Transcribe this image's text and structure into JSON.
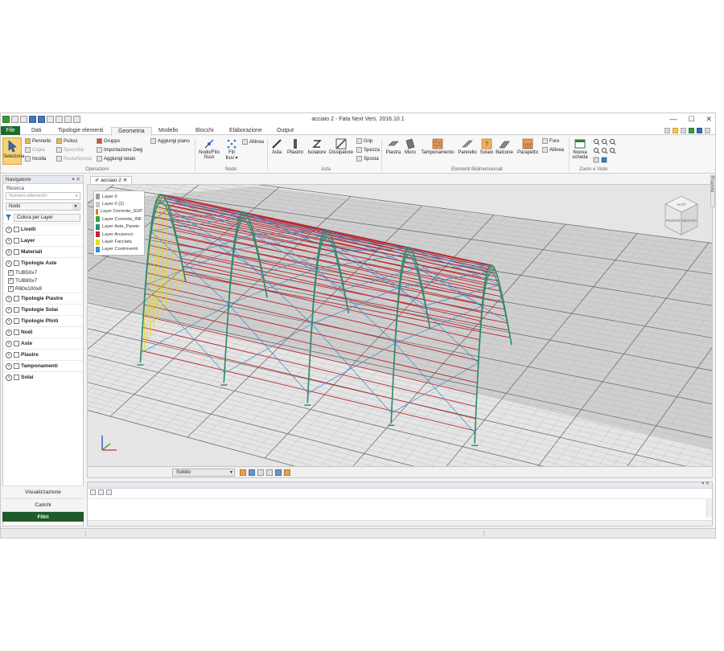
{
  "window": {
    "title": "acciaio 2 - Fata Next Vers. 2016.10.1",
    "controls": [
      "—",
      "☐",
      "✕"
    ]
  },
  "menu_tabs": [
    "File",
    "Dati",
    "Tipologie elementi",
    "Geometria",
    "Modello",
    "Blocchi",
    "Elaborazione",
    "Output"
  ],
  "active_tab": "Geometria",
  "ribbon": {
    "operazioni": {
      "label": "Operazioni",
      "seleziona": "Seleziona",
      "pennello": "Pennello",
      "copia": "Copia",
      "incolla": "Incolla",
      "pulisci": "Pulisci",
      "specchia": "Specchia",
      "ruotasposta": "RuotaSposta",
      "gruppo": "Gruppo",
      "importazione_dwg": "Importazione Dwg",
      "aggiungi_telaio": "Aggiungi telaio",
      "aggiungi_piano": "Aggiungi piano"
    },
    "nodo": {
      "label": "Nodo",
      "nodo_filo_fisso": [
        "Nodo/Filo",
        "fisso"
      ],
      "fili_fissi": [
        "Fili",
        "fissi ▾"
      ],
      "allinea": "Allinea"
    },
    "asta": {
      "label": "Asta",
      "asta": "Asta",
      "pilastro": "Pilastro",
      "isolatore": "Isolatore",
      "dissipatore": "Dissipatore",
      "grip": "Grip",
      "spezza": "Spezza",
      "sposta": "Sposta"
    },
    "elementi_bidimensionali": {
      "label": "Elementi Bidimensionali",
      "piastra": "Piastra",
      "muro": "Muro",
      "tamponamento": "Tamponamento",
      "pannello": "Pannello",
      "solaio": "Solaio",
      "balcone": "Balcone",
      "parapetto": "Parapetto",
      "foro": "Foro",
      "allinea": "Allinea"
    },
    "zoom_viste": {
      "label": "Zoom e Viste",
      "nuova_scheda": [
        "Nuova",
        "scheda"
      ]
    }
  },
  "navigator": {
    "title": "Navigatore",
    "pin": "▾ ✕",
    "search_label": "Ricerca",
    "search_placeholder": "Numero elemento",
    "node_select": "Nodo",
    "color_by": "Colora per Layer",
    "tree": {
      "livelli": "Livelli",
      "layer": "Layer",
      "materiali": "Materiali",
      "tipologie_aste": "Tipologie Aste",
      "aste_items": [
        "TUB50x7",
        "TUB80x7",
        "R80x100x8"
      ],
      "tipologie_piastre": "Tipologie Piastre",
      "tipologie_solai": "Tipologie Solai",
      "tipologie_plinti": "Tipologie Plinti",
      "nodi": "Nodi",
      "aste": "Aste",
      "piastre": "Piastre",
      "tamponamenti": "Tamponamenti",
      "solai": "Solai"
    },
    "bottom": {
      "visualizzazione": "Visualizzazione",
      "carichi": "Carichi",
      "filtri": "Filtri"
    }
  },
  "document_tab": "acciaio 2",
  "document_tab_close": "✕",
  "layers": [
    {
      "name": "Layer 0",
      "color": "#9a9a9a"
    },
    {
      "name": "Layer 0 (2)",
      "color": "#c8c8c8"
    },
    {
      "name": "Layer Corrente_SUP",
      "color": "#e07a1f"
    },
    {
      "name": "Layer Corrente_INF",
      "color": "#3aa33a"
    },
    {
      "name": "Layer Aste_Parete",
      "color": "#2a8a7a"
    },
    {
      "name": "Layer Arcarecci",
      "color": "#c0242a"
    },
    {
      "name": "Layer Facciata",
      "color": "#e8e020"
    },
    {
      "name": "Layer Controventi",
      "color": "#3a8ad0"
    }
  ],
  "view_cube": {
    "top": "ALTO",
    "front": "FRONTE",
    "right": "DESTRA"
  },
  "render_mode": "Solido",
  "side_panel": "Proprietà",
  "colors": {
    "ground": "#cfcfcf",
    "grid": "#b0b0b0",
    "grid_major": "#6f6f6f",
    "frame": "#2e8a6e",
    "purlin": "#b8262c",
    "brace": "#3a8ad0",
    "facade": "#e2d21e",
    "accent_green": "#1e6b2a"
  }
}
